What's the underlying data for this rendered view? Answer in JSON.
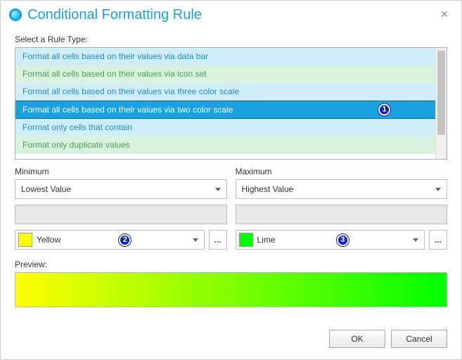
{
  "title": "Conditional Formatting Rule",
  "select_label": "Select a Rule Type:",
  "rules": [
    {
      "label": "Format all cells based on their values via data bar",
      "selected": false
    },
    {
      "label": "Format all cells based on their values via icon set",
      "selected": false
    },
    {
      "label": "Format all cells based on their values via three color scale",
      "selected": false
    },
    {
      "label": "Format all cells based on their values via two color scale",
      "selected": true
    },
    {
      "label": "Format only cells that contain",
      "selected": false
    },
    {
      "label": "Format only duplicate values",
      "selected": false
    }
  ],
  "minimum": {
    "label": "Minimum",
    "type_value": "Lowest Value",
    "color_name": "Yellow",
    "color_hex": "#ffff00"
  },
  "maximum": {
    "label": "Maximum",
    "type_value": "Highest Value",
    "color_name": "Lime",
    "color_hex": "#00ff00"
  },
  "preview_label": "Preview:",
  "buttons": {
    "ok": "OK",
    "cancel": "Cancel"
  },
  "ellipsis": "...",
  "callouts": {
    "rule": "1",
    "min_color": "2",
    "max_color": "3"
  }
}
